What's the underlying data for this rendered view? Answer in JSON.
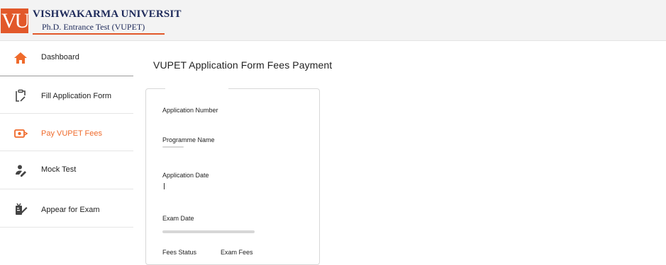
{
  "header": {
    "logo_text": "VU",
    "university_name": "VISHWAKARMA UNIVERSIT",
    "subtitle": "Ph.D. Entrance Test (VUPET)",
    "accent_color": "#e2582a",
    "brand_color": "#1e2a5a"
  },
  "sidebar": {
    "items": [
      {
        "label": "Dashboard",
        "icon": "home-icon",
        "active": false
      },
      {
        "label": "Fill Application Form",
        "icon": "clipboard-icon",
        "active": false
      },
      {
        "label": "Pay VUPET Fees",
        "icon": "payment-icon",
        "active": true
      },
      {
        "label": "Mock Test",
        "icon": "user-edit-icon",
        "active": false
      },
      {
        "label": "Appear for Exam",
        "icon": "exam-icon",
        "active": false
      }
    ],
    "active_color": "#ef6a2b"
  },
  "main": {
    "title": "VUPET Application Form Fees Payment",
    "fields": {
      "application_number_label": "Application Number",
      "programme_name_label": "Programme Name",
      "application_date_label": "Application Date",
      "exam_date_label": "Exam Date",
      "fees_status_label": "Fees Status",
      "exam_fees_label": "Exam Fees"
    }
  }
}
